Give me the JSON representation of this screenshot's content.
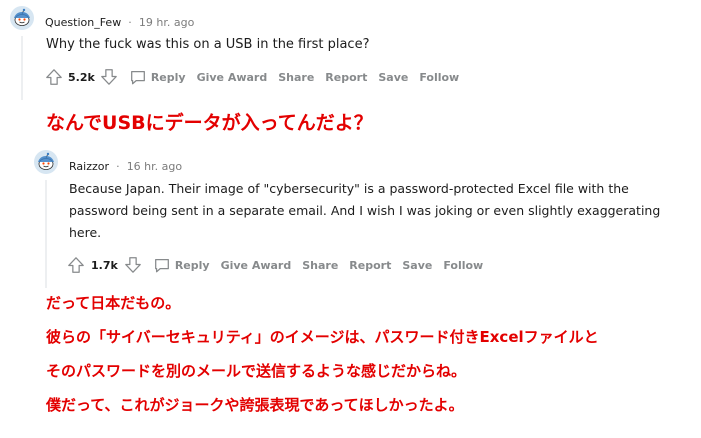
{
  "comment1": {
    "username": "Question_Few",
    "separator": "·",
    "time": "19 hr. ago",
    "body": "Why the fuck was this on a USB in the first place?",
    "score": "5.2k",
    "actions": {
      "reply": "Reply",
      "give_award": "Give Award",
      "share": "Share",
      "report": "Report",
      "save": "Save",
      "follow": "Follow"
    }
  },
  "caption1": "なんでUSBにデータが入ってんだよ？",
  "comment2": {
    "username": "Raizzor",
    "separator": "·",
    "time": "16 hr. ago",
    "body_lines": [
      "Because Japan. Their image of \"cybersecurity\" is a password-protected Excel file with the",
      "password being sent in a separate email. And I wish I was joking or even slightly exaggerating",
      "here."
    ],
    "score": "1.7k",
    "actions": {
      "reply": "Reply",
      "give_award": "Give Award",
      "share": "Share",
      "report": "Report",
      "save": "Save",
      "follow": "Follow"
    }
  },
  "caption2_lines": [
    "だって日本だもの。",
    "彼らの「サイバーセキュリティ」のイメージは、パスワード付きExcelファイルと",
    "そのパスワードを別のメールで送信するような感じだからね。",
    "僕だって、これがジョークや誇張表現であってほしかったよ。"
  ],
  "colors": {
    "caption": "#e30000",
    "meta": "#7c7c7c",
    "action": "#878a8c",
    "thread": "#edeff1"
  }
}
